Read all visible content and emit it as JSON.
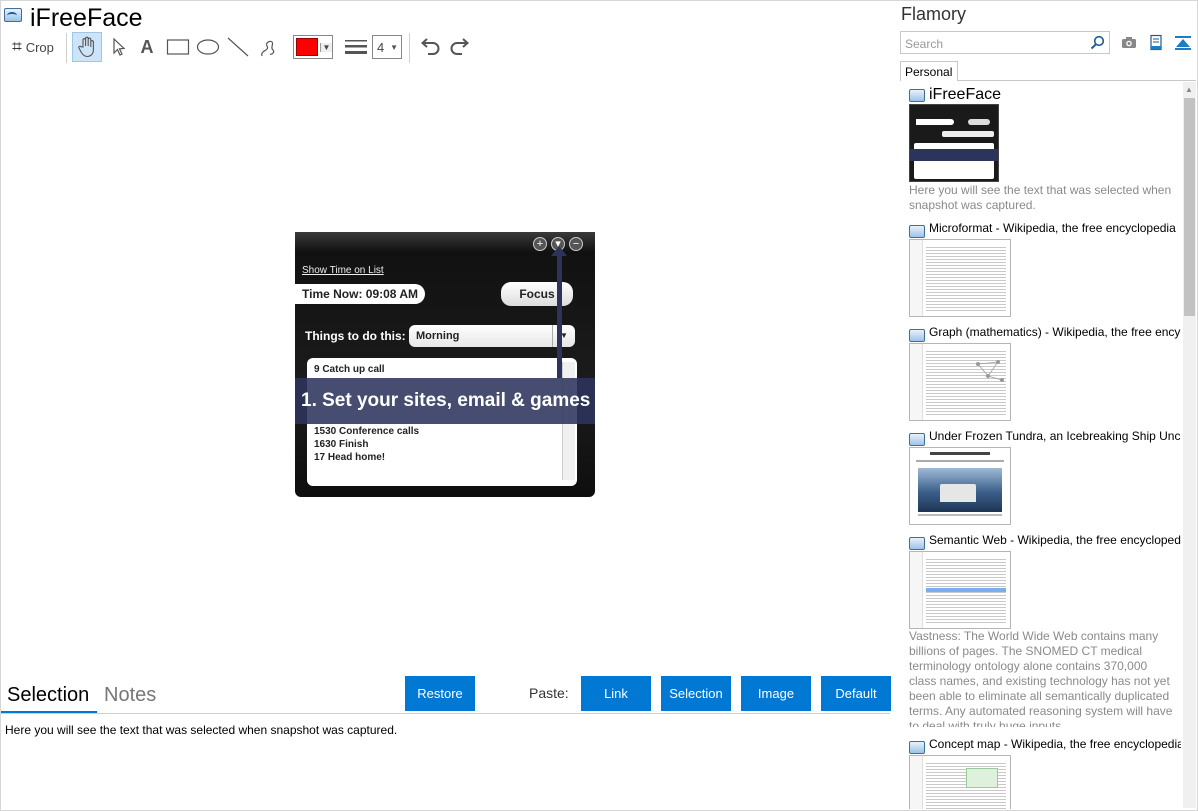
{
  "app": {
    "title": "iFreeFace"
  },
  "toolbar": {
    "crop_label": "Crop",
    "line_width": "4",
    "color": "#ff0000"
  },
  "snapshot": {
    "link": "Show Time on List",
    "time": "Time Now: 09:08 AM",
    "focus": "Focus",
    "things_label": "Things to do this:",
    "period": "Morning",
    "list": [
      "9 Catch up call",
      "1530 Conference calls",
      "1630 Finish",
      "17 Head home!"
    ],
    "banner": "1. Set your sites, email & games"
  },
  "bottom": {
    "tab_selection": "Selection",
    "tab_notes": "Notes",
    "restore": "Restore",
    "paste_label": "Paste:",
    "paste_link": "Link",
    "paste_selection": "Selection",
    "paste_image": "Image",
    "paste_default": "Default",
    "selection_text": "Here you will see the text that was selected when snapshot was captured."
  },
  "flamory": {
    "title": "Flamory",
    "search_placeholder": "Search",
    "tab": "Personal",
    "entries": [
      {
        "title": "iFreeFace",
        "desc": "Here you will see the text that was selected when snapshot was captured."
      },
      {
        "title": "Microformat - Wikipedia, the free encyclopedia",
        "desc": ""
      },
      {
        "title": "Graph (mathematics) - Wikipedia, the free encyc",
        "desc": ""
      },
      {
        "title": "Under Frozen Tundra, an Icebreaking Ship Unco",
        "desc": ""
      },
      {
        "title": "Semantic Web - Wikipedia, the free encycloped",
        "desc": "Vastness: The World Wide Web contains many billions of pages. The SNOMED CT medical terminology ontology alone contains 370,000 class names, and existing technology has not yet been able to eliminate all semantically duplicated terms. Any automated reasoning system will have to deal with truly huge inputs."
      },
      {
        "title": "Concept map - Wikipedia, the free encyclopedia",
        "desc": ""
      }
    ]
  }
}
